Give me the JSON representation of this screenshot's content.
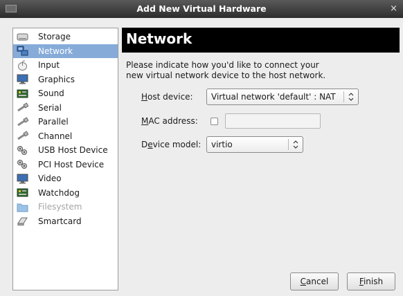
{
  "window": {
    "title": "Add New Virtual Hardware",
    "close_glyph": "×"
  },
  "sidebar": {
    "items": [
      {
        "label": "Storage",
        "icon": "storage-icon"
      },
      {
        "label": "Network",
        "icon": "network-icon",
        "selected": true
      },
      {
        "label": "Input",
        "icon": "input-icon"
      },
      {
        "label": "Graphics",
        "icon": "graphics-icon"
      },
      {
        "label": "Sound",
        "icon": "sound-icon"
      },
      {
        "label": "Serial",
        "icon": "serial-icon"
      },
      {
        "label": "Parallel",
        "icon": "parallel-icon"
      },
      {
        "label": "Channel",
        "icon": "channel-icon"
      },
      {
        "label": "USB Host Device",
        "icon": "usb-host-device-icon"
      },
      {
        "label": "PCI Host Device",
        "icon": "pci-host-device-icon"
      },
      {
        "label": "Video",
        "icon": "video-icon"
      },
      {
        "label": "Watchdog",
        "icon": "watchdog-icon"
      },
      {
        "label": "Filesystem",
        "icon": "filesystem-icon",
        "disabled": true
      },
      {
        "label": "Smartcard",
        "icon": "smartcard-icon"
      }
    ]
  },
  "main": {
    "heading": "Network",
    "intro_line1": "Please indicate how you'd like to connect your",
    "intro_line2": "new virtual network device to the host network.",
    "host_device": {
      "label_mnemonic": "H",
      "label_rest": "ost device:",
      "value": "Virtual network 'default' : NAT"
    },
    "mac_address": {
      "label_mnemonic": "M",
      "label_rest": "AC address:",
      "checked": false,
      "value": ""
    },
    "device_model": {
      "label_pre": "D",
      "label_mnemonic": "e",
      "label_rest": "vice model:",
      "value": "virtio"
    }
  },
  "buttons": {
    "cancel_mnemonic": "C",
    "cancel_rest": "ancel",
    "finish_mnemonic": "F",
    "finish_rest": "inish"
  },
  "colors": {
    "selection": "#86abd9",
    "header_band": "#000000",
    "titlebar": "#3c3c3c"
  }
}
